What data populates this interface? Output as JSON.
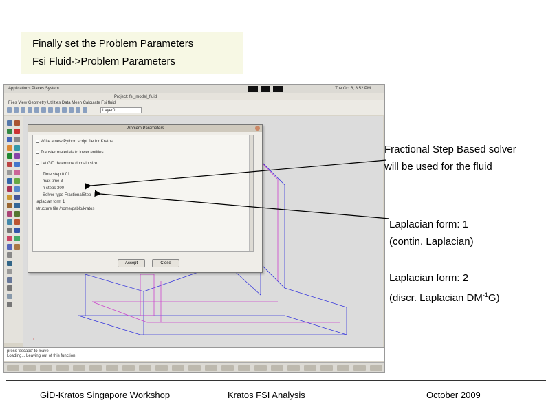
{
  "callout": {
    "line1": "Finally set the Problem Parameters",
    "line2": "Fsi Fluid->Problem Parameters"
  },
  "screenshot": {
    "panel_text": "Applications  Places  System",
    "clock": "Tue Oct 6, 8:52 PM",
    "window_title": "Project: fsi_model_fluid",
    "menu": "Files  View  Geometry  Utilities  Data  Mesh  Calculate  Fsi fluid",
    "layer": "Layer0",
    "command_text": "press 'escape' to leave",
    "command_text2": "Loading... Leaving out of this function",
    "dialog": {
      "title": "Problem Parameters",
      "rows": [
        "Write a new Python script file for Kratos",
        "Transfer materials to lower entities",
        "Let GiD determine domain size",
        "Time step  0.01",
        "max time  3",
        "n steps  300",
        "Solver type  FractionalStep",
        "laplacian form  1",
        "structure file  /home/pablo/kratos"
      ],
      "accept_label": "Accept",
      "close_label": "Close"
    }
  },
  "notes": {
    "fractional_line1": "Fractional Step Based solver",
    "fractional_line2": "will be used for the fluid",
    "lap1_line1": "Laplacian form: 1",
    "lap1_line2": "(contin. Laplacian)",
    "lap2_line1": "Laplacian form: 2",
    "lap2_prefix": "(discr. Laplacian DM",
    "lap2_sup": "-1",
    "lap2_suffix": "G)"
  },
  "footer": {
    "left": "GiD-Kratos Singapore Workshop",
    "center": "Kratos FSI Analysis",
    "right": "October 2009"
  },
  "colors": {
    "callout_bg": "#f7f8e4",
    "mesh_blue": "#3b3bdd",
    "mesh_magenta": "#cc44cc"
  }
}
